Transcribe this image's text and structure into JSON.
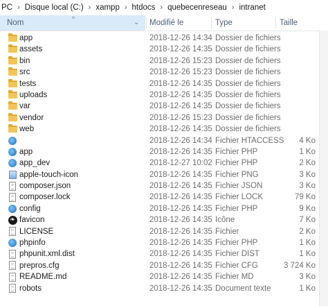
{
  "breadcrumb": [
    "PC",
    "Disque local (C:)",
    "xampp",
    "htdocs",
    "quebecenreseau",
    "intranet"
  ],
  "columns": {
    "name": "Nom",
    "date": "Modifié le",
    "type": "Type",
    "size": "Taille"
  },
  "files": [
    {
      "icon": "folder",
      "name": "app",
      "date": "2018-12-26 14:34",
      "type": "Dossier de fichiers",
      "size": ""
    },
    {
      "icon": "folder",
      "name": "assets",
      "date": "2018-12-26 14:35",
      "type": "Dossier de fichiers",
      "size": ""
    },
    {
      "icon": "folder",
      "name": "bin",
      "date": "2018-12-26 15:23",
      "type": "Dossier de fichiers",
      "size": ""
    },
    {
      "icon": "folder",
      "name": "src",
      "date": "2018-12-26 15:23",
      "type": "Dossier de fichiers",
      "size": ""
    },
    {
      "icon": "folder",
      "name": "tests",
      "date": "2018-12-26 14:35",
      "type": "Dossier de fichiers",
      "size": ""
    },
    {
      "icon": "folder",
      "name": "uploads",
      "date": "2018-12-26 14:35",
      "type": "Dossier de fichiers",
      "size": ""
    },
    {
      "icon": "folder",
      "name": "var",
      "date": "2018-12-26 14:35",
      "type": "Dossier de fichiers",
      "size": ""
    },
    {
      "icon": "folder",
      "name": "vendor",
      "date": "2018-12-26 15:23",
      "type": "Dossier de fichiers",
      "size": ""
    },
    {
      "icon": "folder",
      "name": "web",
      "date": "2018-12-26 14:35",
      "type": "Dossier de fichiers",
      "size": ""
    },
    {
      "icon": "php",
      "name": "",
      "date": "2018-12-26 14:34",
      "type": "Fichier HTACCESS",
      "size": "4 Ko"
    },
    {
      "icon": "php",
      "name": "app",
      "date": "2018-12-26 14:35",
      "type": "Fichier PHP",
      "size": "1 Ko"
    },
    {
      "icon": "php",
      "name": "app_dev",
      "date": "2018-12-27 10:02",
      "type": "Fichier PHP",
      "size": "2 Ko"
    },
    {
      "icon": "image",
      "name": "apple-touch-icon",
      "date": "2018-12-26 14:35",
      "type": "Fichier PNG",
      "size": "3 Ko"
    },
    {
      "icon": "document",
      "name": "composer.json",
      "date": "2018-12-26 14:35",
      "type": "Fichier JSON",
      "size": "3 Ko"
    },
    {
      "icon": "document",
      "name": "composer.lock",
      "date": "2018-12-26 14:35",
      "type": "Fichier LOCK",
      "size": "79 Ko"
    },
    {
      "icon": "php",
      "name": "config",
      "date": "2018-12-26 14:35",
      "type": "Fichier PHP",
      "size": "9 Ko"
    },
    {
      "icon": "favicon",
      "name": "favicon",
      "date": "2018-12-26 14:35",
      "type": "Icône",
      "size": "7 Ko"
    },
    {
      "icon": "document",
      "name": "LICENSE",
      "date": "2018-12-26 14:35",
      "type": "Fichier",
      "size": "2 Ko"
    },
    {
      "icon": "php",
      "name": "phpinfo",
      "date": "2018-12-26 14:35",
      "type": "Fichier PHP",
      "size": "1 Ko"
    },
    {
      "icon": "document",
      "name": "phpunit.xml.dist",
      "date": "2018-12-26 14:35",
      "type": "Fichier DIST",
      "size": "1 Ko"
    },
    {
      "icon": "document",
      "name": "prepros.cfg",
      "date": "2018-12-26 14:35",
      "type": "Fichier CFG",
      "size": "3 724 Ko"
    },
    {
      "icon": "document",
      "name": "README.md",
      "date": "2018-12-26 14:35",
      "type": "Fichier MD",
      "size": "3 Ko"
    },
    {
      "icon": "document",
      "name": "robots",
      "date": "2018-12-26 14:35",
      "type": "Document texte",
      "size": "1 Ko"
    }
  ]
}
